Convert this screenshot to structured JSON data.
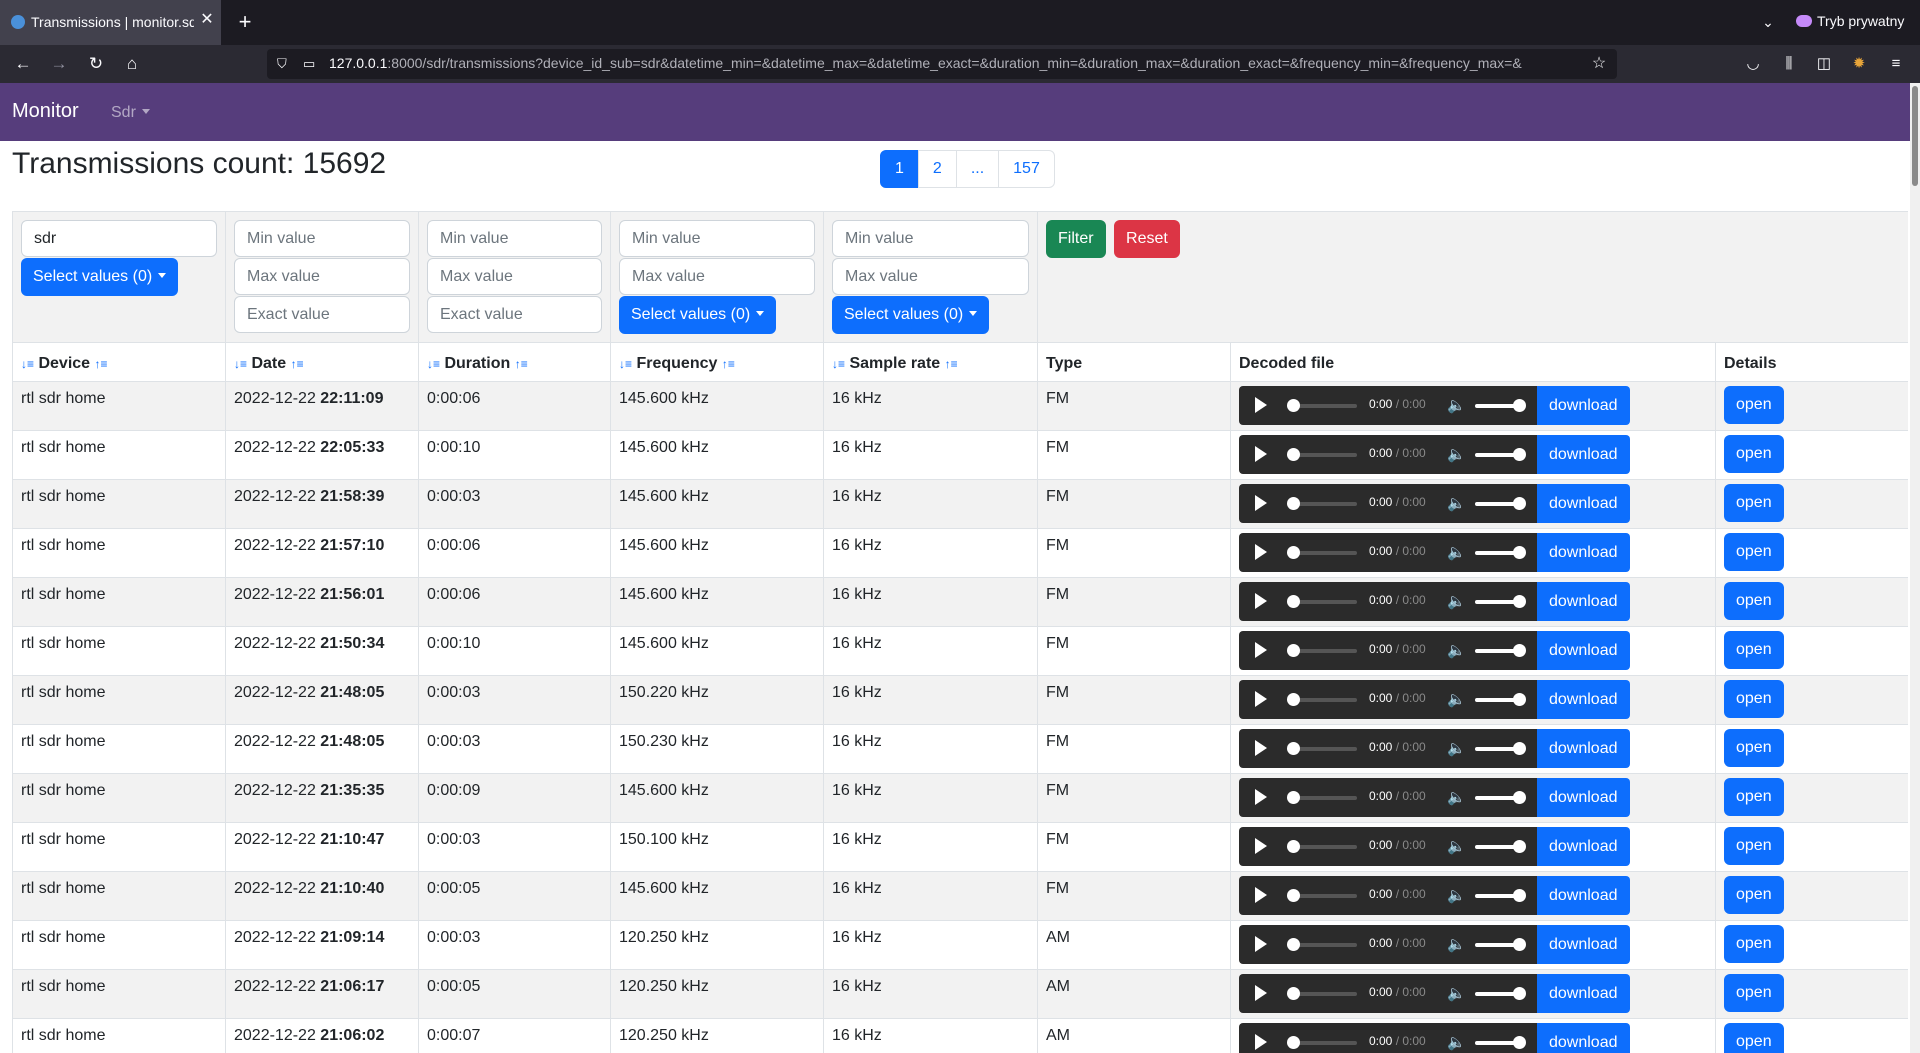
{
  "browser": {
    "tab_title": "Transmissions | monitor.sd",
    "private_label": "Tryb prywatny",
    "url_host": "127.0.0.1",
    "url_rest": ":8000/sdr/transmissions?device_id_sub=sdr&datetime_min=&datetime_max=&datetime_exact=&duration_min=&duration_max=&duration_exact=&frequency_min=&frequency_max=&"
  },
  "app": {
    "brand": "Monitor",
    "nav_dropdown": "Sdr"
  },
  "page": {
    "title": "Transmissions count: 15692"
  },
  "pagination": [
    "1",
    "2",
    "...",
    "157"
  ],
  "filters": {
    "device_value": "sdr",
    "select_values": "Select values (0)",
    "min_placeholder": "Min value",
    "max_placeholder": "Max value",
    "exact_placeholder": "Exact value",
    "filter_label": "Filter",
    "reset_label": "Reset"
  },
  "columns": {
    "device": "Device",
    "date": "Date",
    "duration": "Duration",
    "frequency": "Frequency",
    "sample_rate": "Sample rate",
    "type": "Type",
    "decoded_file": "Decoded file",
    "details": "Details"
  },
  "player": {
    "time_current": "0:00",
    "time_sep": " / ",
    "time_total": "0:00",
    "download_label": "download",
    "open_label": "open"
  },
  "rows": [
    {
      "device": "rtl sdr home",
      "date": "2022-12-22",
      "time": "22:11:09",
      "duration": "0:00:06",
      "frequency": "145.600 kHz",
      "sample_rate": "16 kHz",
      "type": "FM"
    },
    {
      "device": "rtl sdr home",
      "date": "2022-12-22",
      "time": "22:05:33",
      "duration": "0:00:10",
      "frequency": "145.600 kHz",
      "sample_rate": "16 kHz",
      "type": "FM"
    },
    {
      "device": "rtl sdr home",
      "date": "2022-12-22",
      "time": "21:58:39",
      "duration": "0:00:03",
      "frequency": "145.600 kHz",
      "sample_rate": "16 kHz",
      "type": "FM"
    },
    {
      "device": "rtl sdr home",
      "date": "2022-12-22",
      "time": "21:57:10",
      "duration": "0:00:06",
      "frequency": "145.600 kHz",
      "sample_rate": "16 kHz",
      "type": "FM"
    },
    {
      "device": "rtl sdr home",
      "date": "2022-12-22",
      "time": "21:56:01",
      "duration": "0:00:06",
      "frequency": "145.600 kHz",
      "sample_rate": "16 kHz",
      "type": "FM"
    },
    {
      "device": "rtl sdr home",
      "date": "2022-12-22",
      "time": "21:50:34",
      "duration": "0:00:10",
      "frequency": "145.600 kHz",
      "sample_rate": "16 kHz",
      "type": "FM"
    },
    {
      "device": "rtl sdr home",
      "date": "2022-12-22",
      "time": "21:48:05",
      "duration": "0:00:03",
      "frequency": "150.220 kHz",
      "sample_rate": "16 kHz",
      "type": "FM"
    },
    {
      "device": "rtl sdr home",
      "date": "2022-12-22",
      "time": "21:48:05",
      "duration": "0:00:03",
      "frequency": "150.230 kHz",
      "sample_rate": "16 kHz",
      "type": "FM"
    },
    {
      "device": "rtl sdr home",
      "date": "2022-12-22",
      "time": "21:35:35",
      "duration": "0:00:09",
      "frequency": "145.600 kHz",
      "sample_rate": "16 kHz",
      "type": "FM"
    },
    {
      "device": "rtl sdr home",
      "date": "2022-12-22",
      "time": "21:10:47",
      "duration": "0:00:03",
      "frequency": "150.100 kHz",
      "sample_rate": "16 kHz",
      "type": "FM"
    },
    {
      "device": "rtl sdr home",
      "date": "2022-12-22",
      "time": "21:10:40",
      "duration": "0:00:05",
      "frequency": "145.600 kHz",
      "sample_rate": "16 kHz",
      "type": "FM"
    },
    {
      "device": "rtl sdr home",
      "date": "2022-12-22",
      "time": "21:09:14",
      "duration": "0:00:03",
      "frequency": "120.250 kHz",
      "sample_rate": "16 kHz",
      "type": "AM"
    },
    {
      "device": "rtl sdr home",
      "date": "2022-12-22",
      "time": "21:06:17",
      "duration": "0:00:05",
      "frequency": "120.250 kHz",
      "sample_rate": "16 kHz",
      "type": "AM"
    },
    {
      "device": "rtl sdr home",
      "date": "2022-12-22",
      "time": "21:06:02",
      "duration": "0:00:07",
      "frequency": "120.250 kHz",
      "sample_rate": "16 kHz",
      "type": "AM"
    }
  ]
}
